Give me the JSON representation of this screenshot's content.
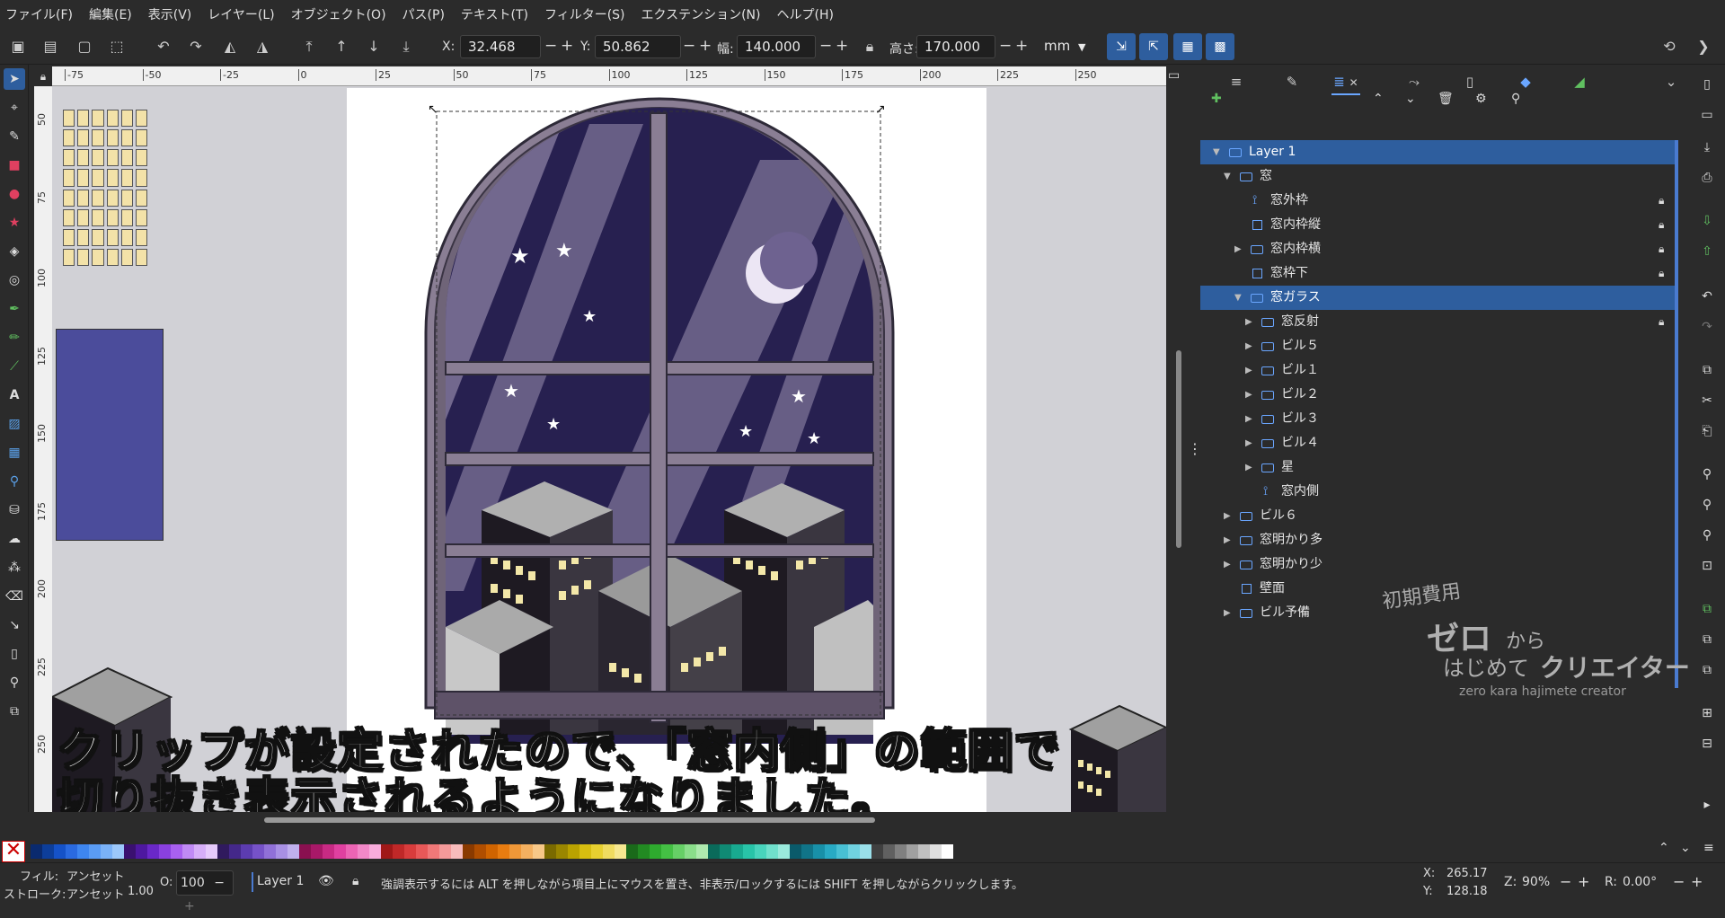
{
  "menu": [
    "ファイル(F)",
    "編集(E)",
    "表示(V)",
    "レイヤー(L)",
    "オブジェクト(O)",
    "パス(P)",
    "テキスト(T)",
    "フィルター(S)",
    "エクステンション(N)",
    "ヘルプ(H)"
  ],
  "controls": {
    "x_label": "X:",
    "x_value": "32.468",
    "y_label": "Y:",
    "y_value": "50.862",
    "w_label": "幅:",
    "w_value": "140.000",
    "h_label": "高さ:",
    "h_value": "170.000",
    "unit": "mm"
  },
  "ruler_h": [
    "-75",
    "-50",
    "-25",
    "0",
    "25",
    "50",
    "75",
    "100",
    "125",
    "150",
    "175",
    "200",
    "225",
    "250"
  ],
  "ruler_v": [
    "50",
    "75",
    "100",
    "125",
    "150",
    "175",
    "200",
    "225",
    "250"
  ],
  "layers": [
    {
      "label": "Layer 1",
      "level": 0,
      "expanded": true,
      "selected": true,
      "lock": false,
      "icon": "layer"
    },
    {
      "label": "窓",
      "level": 1,
      "expanded": true,
      "selected": false,
      "lock": false,
      "icon": "folder"
    },
    {
      "label": "窓外枠",
      "level": 2,
      "expanded": null,
      "selected": false,
      "lock": true,
      "icon": "path"
    },
    {
      "label": "窓内枠縦",
      "level": 2,
      "expanded": null,
      "selected": false,
      "lock": true,
      "icon": "rect"
    },
    {
      "label": "窓内枠横",
      "level": 2,
      "expanded": false,
      "selected": false,
      "lock": true,
      "icon": "folder"
    },
    {
      "label": "窓枠下",
      "level": 2,
      "expanded": null,
      "selected": false,
      "lock": true,
      "icon": "rect"
    },
    {
      "label": "窓ガラス",
      "level": 2,
      "expanded": true,
      "selected": true,
      "lock": false,
      "icon": "clip"
    },
    {
      "label": "窓反射",
      "level": 3,
      "expanded": false,
      "selected": false,
      "lock": true,
      "icon": "folder"
    },
    {
      "label": "ビル５",
      "level": 3,
      "expanded": false,
      "selected": false,
      "lock": false,
      "icon": "folder"
    },
    {
      "label": "ビル１",
      "level": 3,
      "expanded": false,
      "selected": false,
      "lock": false,
      "icon": "folder"
    },
    {
      "label": "ビル２",
      "level": 3,
      "expanded": false,
      "selected": false,
      "lock": false,
      "icon": "folder"
    },
    {
      "label": "ビル３",
      "level": 3,
      "expanded": false,
      "selected": false,
      "lock": false,
      "icon": "folder"
    },
    {
      "label": "ビル４",
      "level": 3,
      "expanded": false,
      "selected": false,
      "lock": false,
      "icon": "folder"
    },
    {
      "label": "星",
      "level": 3,
      "expanded": false,
      "selected": false,
      "lock": false,
      "icon": "folder"
    },
    {
      "label": "窓内側",
      "level": 3,
      "expanded": null,
      "selected": false,
      "lock": false,
      "icon": "path"
    },
    {
      "label": "ビル６",
      "level": 1,
      "expanded": false,
      "selected": false,
      "lock": false,
      "icon": "folder"
    },
    {
      "label": "窓明かり多",
      "level": 1,
      "expanded": false,
      "selected": false,
      "lock": false,
      "icon": "folder"
    },
    {
      "label": "窓明かり少",
      "level": 1,
      "expanded": false,
      "selected": false,
      "lock": false,
      "icon": "folder"
    },
    {
      "label": "壁面",
      "level": 1,
      "expanded": null,
      "selected": false,
      "lock": false,
      "icon": "rect"
    },
    {
      "label": "ビル予備",
      "level": 1,
      "expanded": false,
      "selected": false,
      "lock": false,
      "icon": "folder"
    }
  ],
  "subtitle": {
    "line1": "クリップが設定されたので、「窓内側」の範囲で",
    "line2": "切り抜き表示されるようになりました。"
  },
  "watermark": {
    "small": "初期費用",
    "big1": "ゼロ",
    "from": "から",
    "big2": "はじめて",
    "big3": "クリエイター",
    "romaji": "zero kara hajimete creator"
  },
  "status": {
    "fill_label": "フィル:",
    "fill_value": "アンセット",
    "stroke_label": "ストローク:",
    "stroke_value": "アンセット",
    "stroke_width": "1.00",
    "opacity_label": "O:",
    "opacity_value": "100",
    "layer": "Layer 1",
    "message": "強調表示するには ALT を押しながら項目上にマウスを置き、非表示/ロックするには SHIFT を押しながらクリックします。",
    "x_label": "X:",
    "x_value": "265.17",
    "y_label": "Y:",
    "y_value": "128.18",
    "zoom_label": "Z:",
    "zoom_value": "90%",
    "rot_label": "R:",
    "rot_value": "0.00°"
  },
  "palette": [
    "#0a2a6e",
    "#0d3e9a",
    "#1552c8",
    "#2a6ae0",
    "#3e86f0",
    "#5a9cf5",
    "#7ab2f8",
    "#9cc8fb",
    "#3a1070",
    "#4e18a0",
    "#6a28c8",
    "#8a40e0",
    "#a860f0",
    "#c08af5",
    "#d6aef8",
    "#e6cafb",
    "#301a5e",
    "#44288a",
    "#5c3cb0",
    "#7652c8",
    "#9070d8",
    "#a890e4",
    "#c0b0ee",
    "#8a1050",
    "#a81868",
    "#c82a84",
    "#e040a0",
    "#ec64b4",
    "#f288c8",
    "#f8acdc",
    "#a01818",
    "#c02828",
    "#d83c3c",
    "#e85858",
    "#f07878",
    "#f49a9a",
    "#f8bcbc",
    "#8a3a00",
    "#b04e00",
    "#d06400",
    "#e87c10",
    "#f09838",
    "#f4b060",
    "#f8c888",
    "#7a6a00",
    "#9a8600",
    "#baa200",
    "#d8be10",
    "#e8d030",
    "#f0dc60",
    "#f6e890",
    "#1a6a1a",
    "#228a22",
    "#2eaa2e",
    "#44c044",
    "#66d066",
    "#8ade8a",
    "#aeeaae",
    "#0a6a5a",
    "#108a74",
    "#18aa90",
    "#28c4a8",
    "#48d4bc",
    "#70e0cc",
    "#9aeadc",
    "#0a5a6a",
    "#107488",
    "#1890a8",
    "#28aac4",
    "#48c0d4",
    "#70d2e0",
    "#9ae0ea",
    "#404040",
    "#606060",
    "#808080",
    "#a0a0a0",
    "#c0c0c0",
    "#e0e0e0",
    "#ffffff"
  ]
}
